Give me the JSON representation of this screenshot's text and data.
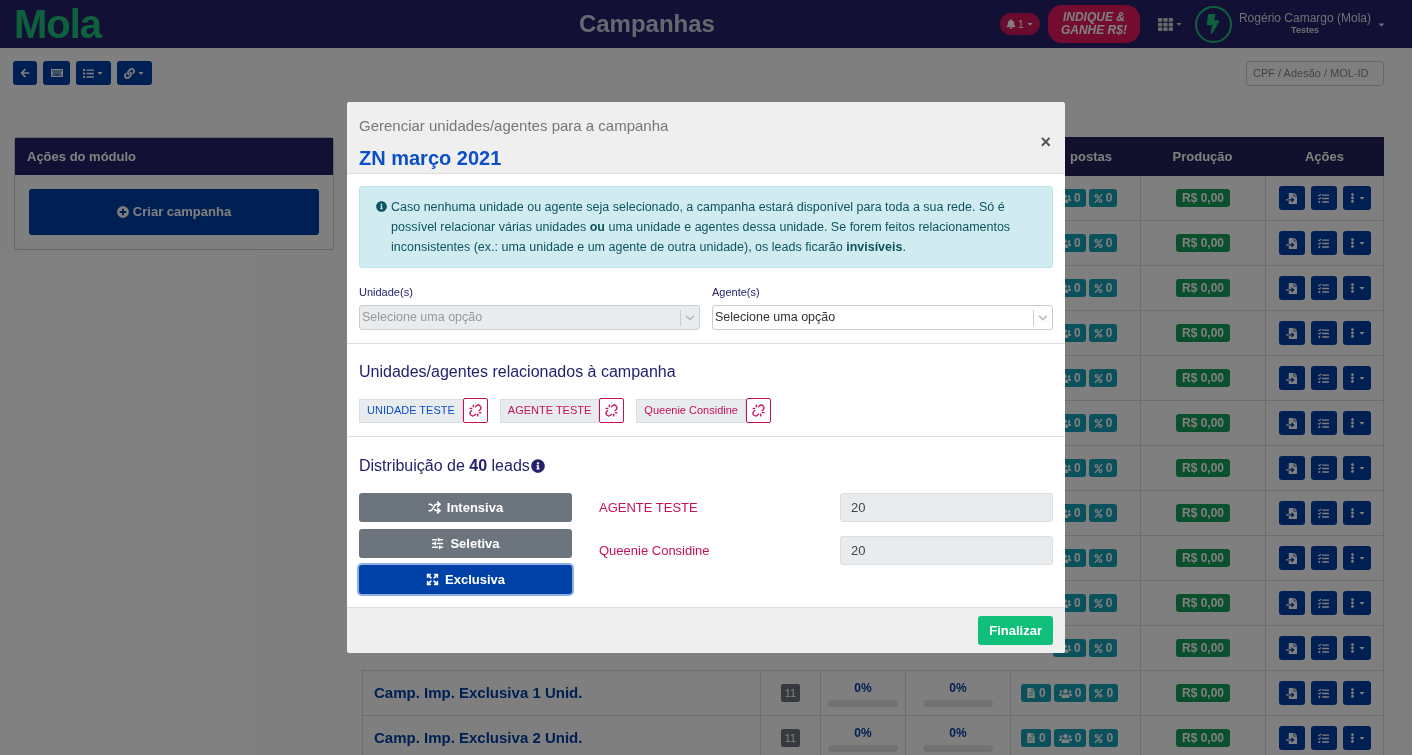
{
  "navbar": {
    "logo": "Mola",
    "title": "Campanhas",
    "notifications": "1",
    "promo": [
      "INDIQUE &",
      "GANHE R$!"
    ],
    "user": {
      "name": "Rogério Camargo (Mola)",
      "subtitle": "Testes"
    }
  },
  "toolbar": {
    "search": {
      "placeholder": "CPF / Adesão / MOL-ID"
    }
  },
  "sidebar": {
    "title": "Ações do módulo",
    "button": "Criar campanha"
  },
  "table": {
    "columns": [
      {
        "label": "postas"
      },
      {
        "label": "Produção"
      },
      {
        "label": "Ações"
      }
    ],
    "rows": [
      {
        "kind": "covered",
        "badges": [
          {
            "kind": "people",
            "value": "0"
          },
          {
            "kind": "percent",
            "value": "0"
          }
        ],
        "production": "R$ 0,00"
      },
      {
        "kind": "covered",
        "badges": [
          {
            "kind": "people",
            "value": "0"
          },
          {
            "kind": "percent",
            "value": "0"
          }
        ],
        "production": "R$ 0,00"
      },
      {
        "kind": "covered",
        "badges": [
          {
            "kind": "people",
            "value": "0"
          },
          {
            "kind": "percent",
            "value": "0"
          }
        ],
        "production": "R$ 0,00"
      },
      {
        "kind": "covered",
        "badges": [
          {
            "kind": "people",
            "value": "0"
          },
          {
            "kind": "percent",
            "value": "0"
          }
        ],
        "production": "R$ 0,00"
      },
      {
        "kind": "covered",
        "badges": [
          {
            "kind": "people",
            "value": "0"
          },
          {
            "kind": "percent",
            "value": "0"
          }
        ],
        "production": "R$ 0,00"
      },
      {
        "kind": "covered",
        "badges": [
          {
            "kind": "people",
            "value": "0"
          },
          {
            "kind": "percent",
            "value": "0"
          }
        ],
        "production": "R$ 0,00"
      },
      {
        "kind": "covered",
        "badges": [
          {
            "kind": "people",
            "value": "0"
          },
          {
            "kind": "percent",
            "value": "0"
          }
        ],
        "production": "R$ 0,00"
      },
      {
        "kind": "covered",
        "badges": [
          {
            "kind": "people",
            "value": "0"
          },
          {
            "kind": "percent",
            "value": "0"
          }
        ],
        "production": "R$ 0,00"
      },
      {
        "kind": "covered",
        "badges": [
          {
            "kind": "people",
            "value": "0"
          },
          {
            "kind": "percent",
            "value": "0"
          }
        ],
        "production": "R$ 0,00"
      },
      {
        "kind": "covered",
        "badges": [
          {
            "kind": "people",
            "value": "0"
          },
          {
            "kind": "percent",
            "value": "0"
          }
        ],
        "production": "R$ 0,00"
      },
      {
        "kind": "covered",
        "badges": [
          {
            "kind": "people",
            "value": "0"
          },
          {
            "kind": "percent",
            "value": "0"
          }
        ],
        "production": "R$ 0,00"
      },
      {
        "kind": "full",
        "name": "Camp. Imp. Exclusiva 1 Unid.",
        "count": "11",
        "progress": [
          {
            "text": "0%",
            "level": 0
          },
          {
            "text": "0%",
            "level": 0
          }
        ],
        "badges": [
          {
            "kind": "document",
            "value": "0"
          },
          {
            "kind": "people",
            "value": "0"
          },
          {
            "kind": "percent",
            "value": "0"
          }
        ],
        "production": "R$ 0,00"
      },
      {
        "kind": "full",
        "name": "Camp. Imp. Exclusiva 2 Unid.",
        "count": "11",
        "progress": [
          {
            "text": "0%",
            "level": 0
          },
          {
            "text": "0%",
            "level": 0
          }
        ],
        "badges": [
          {
            "kind": "document",
            "value": "0"
          },
          {
            "kind": "people",
            "value": "0"
          },
          {
            "kind": "percent",
            "value": "0"
          }
        ],
        "production": "R$ 0,00"
      }
    ]
  },
  "modal": {
    "subtitle": "Gerenciar unidades/agentes para a campanha",
    "title": "ZN março 2021",
    "close": "×",
    "alert": "Caso nenhuma unidade ou agente seja selecionado, a campanha estará disponível para toda a sua rede. Só é possível relacionar várias unidades **ou** uma unidade e agentes dessa unidade. Se forem feitos relacionamentos inconsistentes (ex.: uma unidade e um agente de outra unidade), os leads ficarão **invisíveis**.",
    "fields": [
      {
        "label": "Unidade(s)",
        "placeholder": "Selecione uma opção",
        "disabled": true
      },
      {
        "label": "Agente(s)",
        "placeholder": "Selecione uma opção",
        "disabled": false
      }
    ],
    "related_title": "Unidades/agentes relacionados à campanha",
    "related": [
      {
        "label": "UNIDADE TESTE",
        "kind": "unit"
      },
      {
        "label": "AGENTE TESTE",
        "kind": "agent"
      },
      {
        "label": "Queenie Considine",
        "kind": "agent"
      }
    ],
    "distribution": {
      "title": "Distribuição de **40** leads",
      "modes": [
        {
          "label": "Intensiva",
          "kind": "shuffle",
          "selected": false
        },
        {
          "label": "Seletiva",
          "kind": "sliders",
          "selected": false
        },
        {
          "label": "Exclusiva",
          "kind": "expand",
          "selected": true
        }
      ],
      "agents": [
        {
          "name": "AGENTE TESTE",
          "value": "20"
        },
        {
          "name": "Queenie Considine",
          "value": "20"
        }
      ]
    },
    "submit": "Finalizar"
  }
}
